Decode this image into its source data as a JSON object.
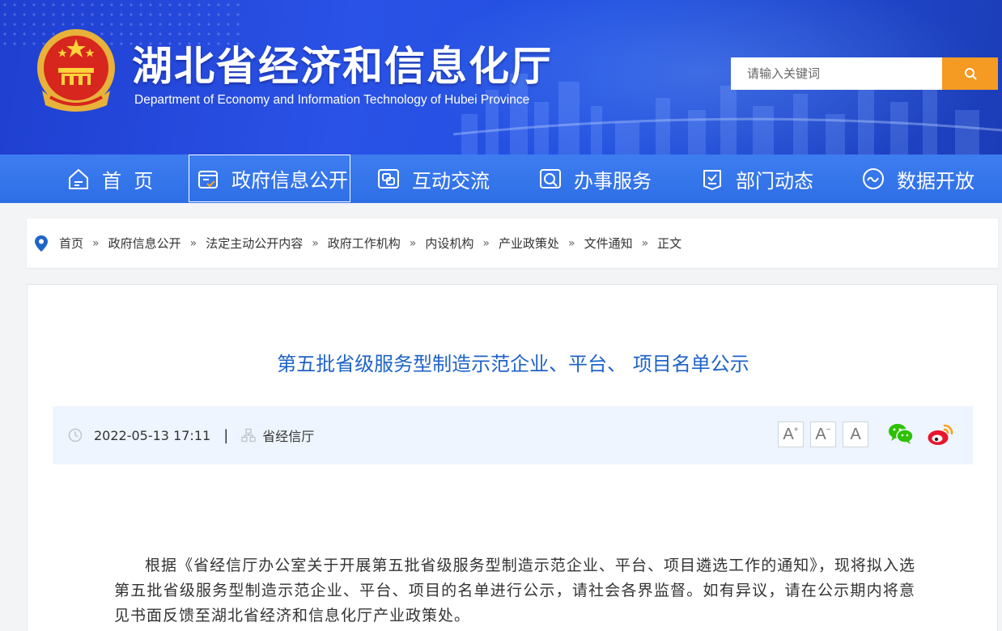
{
  "header": {
    "title_cn": "湖北省经济和信息化厅",
    "title_en": "Department of Economy and Information Technology of Hubei Province",
    "search": {
      "placeholder": "请输入关键词",
      "icon": "search-icon"
    },
    "colors": {
      "accent": "#f59a23",
      "banner": "#2a52e6"
    }
  },
  "nav": {
    "items": [
      {
        "label": "首  页",
        "icon": "home-icon"
      },
      {
        "label": "政府信息公开",
        "icon": "document-icon",
        "active": true
      },
      {
        "label": "互动交流",
        "icon": "chat-icon"
      },
      {
        "label": "办事服务",
        "icon": "service-icon"
      },
      {
        "label": "部门动态",
        "icon": "news-icon"
      },
      {
        "label": "数据开放",
        "icon": "data-icon"
      }
    ]
  },
  "breadcrumb": {
    "icon": "location-pin-icon",
    "items": [
      "首页",
      "政府信息公开",
      "法定主动公开内容",
      "政府工作机构",
      "内设机构",
      "产业政策处",
      "文件通知",
      "正文"
    ],
    "separator": "»"
  },
  "article": {
    "title": "第五批省级服务型制造示范企业、平台、 项目名单公示",
    "date": "2022-05-13 17:11",
    "separator": "|",
    "source": "省经信厅",
    "font_controls": [
      "A",
      "A",
      "A"
    ],
    "share": [
      "wechat-icon",
      "weibo-icon"
    ],
    "body": "根据《省经信厅办公室关于开展第五批省级服务型制造示范企业、平台、项目遴选工作的通知》，现将拟入选第五批省级服务型制造示范企业、平台、项目的名单进行公示，请社会各界监督。如有异议，请在公示期内将意见书面反馈至湖北省经济和信息化厅产业政策处。"
  }
}
